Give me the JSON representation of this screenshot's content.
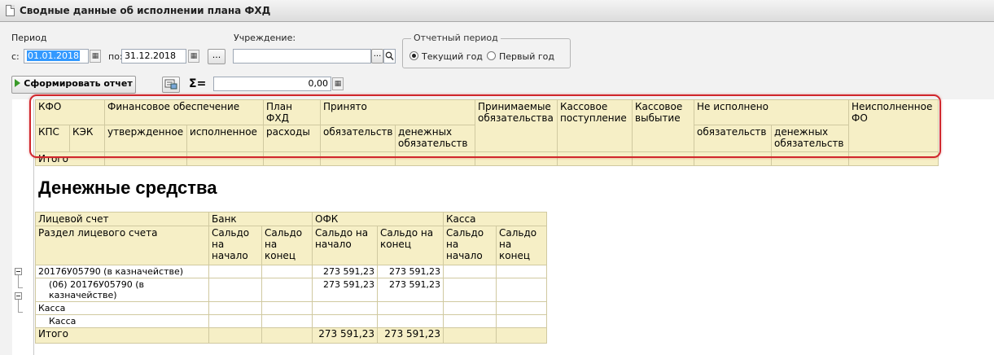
{
  "window": {
    "title": "Сводные данные об исполнении плана ФХД"
  },
  "period": {
    "label": "Период",
    "from_label": "с:",
    "from_value": "01.01.2018",
    "to_label": "по:",
    "to_value": "31.12.2018",
    "more_button": "..."
  },
  "institution": {
    "label": "Учреждение:",
    "value": "",
    "select_button": "..."
  },
  "report_period": {
    "title": "Отчетный период",
    "options": [
      {
        "label": "Текущий год",
        "selected": true
      },
      {
        "label": "Первый год",
        "selected": false
      }
    ]
  },
  "toolbar": {
    "run_button": "Сформировать отчет",
    "sum_label": "Σ=",
    "sum_value": "0,00"
  },
  "summary_table": {
    "header_row1": [
      "КФО",
      "Финансовое обеспечение",
      "План ФХД",
      "Принято",
      "Принимаемые обязательства",
      "Кассовое поступление",
      "Кассовое выбытие",
      "Не исполнено",
      "Неисполненное ФО"
    ],
    "header_row2": [
      "КПС",
      "КЭК",
      "утвержденное",
      "исполненное",
      "расходы",
      "обязательств",
      "денежных обязательств",
      "обязательств",
      "денежных обязательств"
    ],
    "total_label": "Итого"
  },
  "money": {
    "section_title": "Денежные средства",
    "headers": {
      "account": "Лицевой счет",
      "bank": "Банк",
      "ofk": "ОФК",
      "cash": "Касса",
      "section": "Раздел лицевого счета",
      "start": "Сальдо на начало",
      "end": "Сальдо на конец"
    },
    "rows": [
      {
        "name": "20176У05790 (в казначействе)",
        "ofk_start": "273 591,23",
        "ofk_end": "273 591,23"
      },
      {
        "name": "(06) 20176У05790 (в казначействе)",
        "ofk_start": "273 591,23",
        "ofk_end": "273 591,23"
      },
      {
        "name": "Касса",
        "ofk_start": "",
        "ofk_end": ""
      },
      {
        "name": "Касса",
        "ofk_start": "",
        "ofk_end": ""
      }
    ],
    "total": {
      "label": "Итого",
      "ofk_start": "273 591,23",
      "ofk_end": "273 591,23"
    }
  }
}
